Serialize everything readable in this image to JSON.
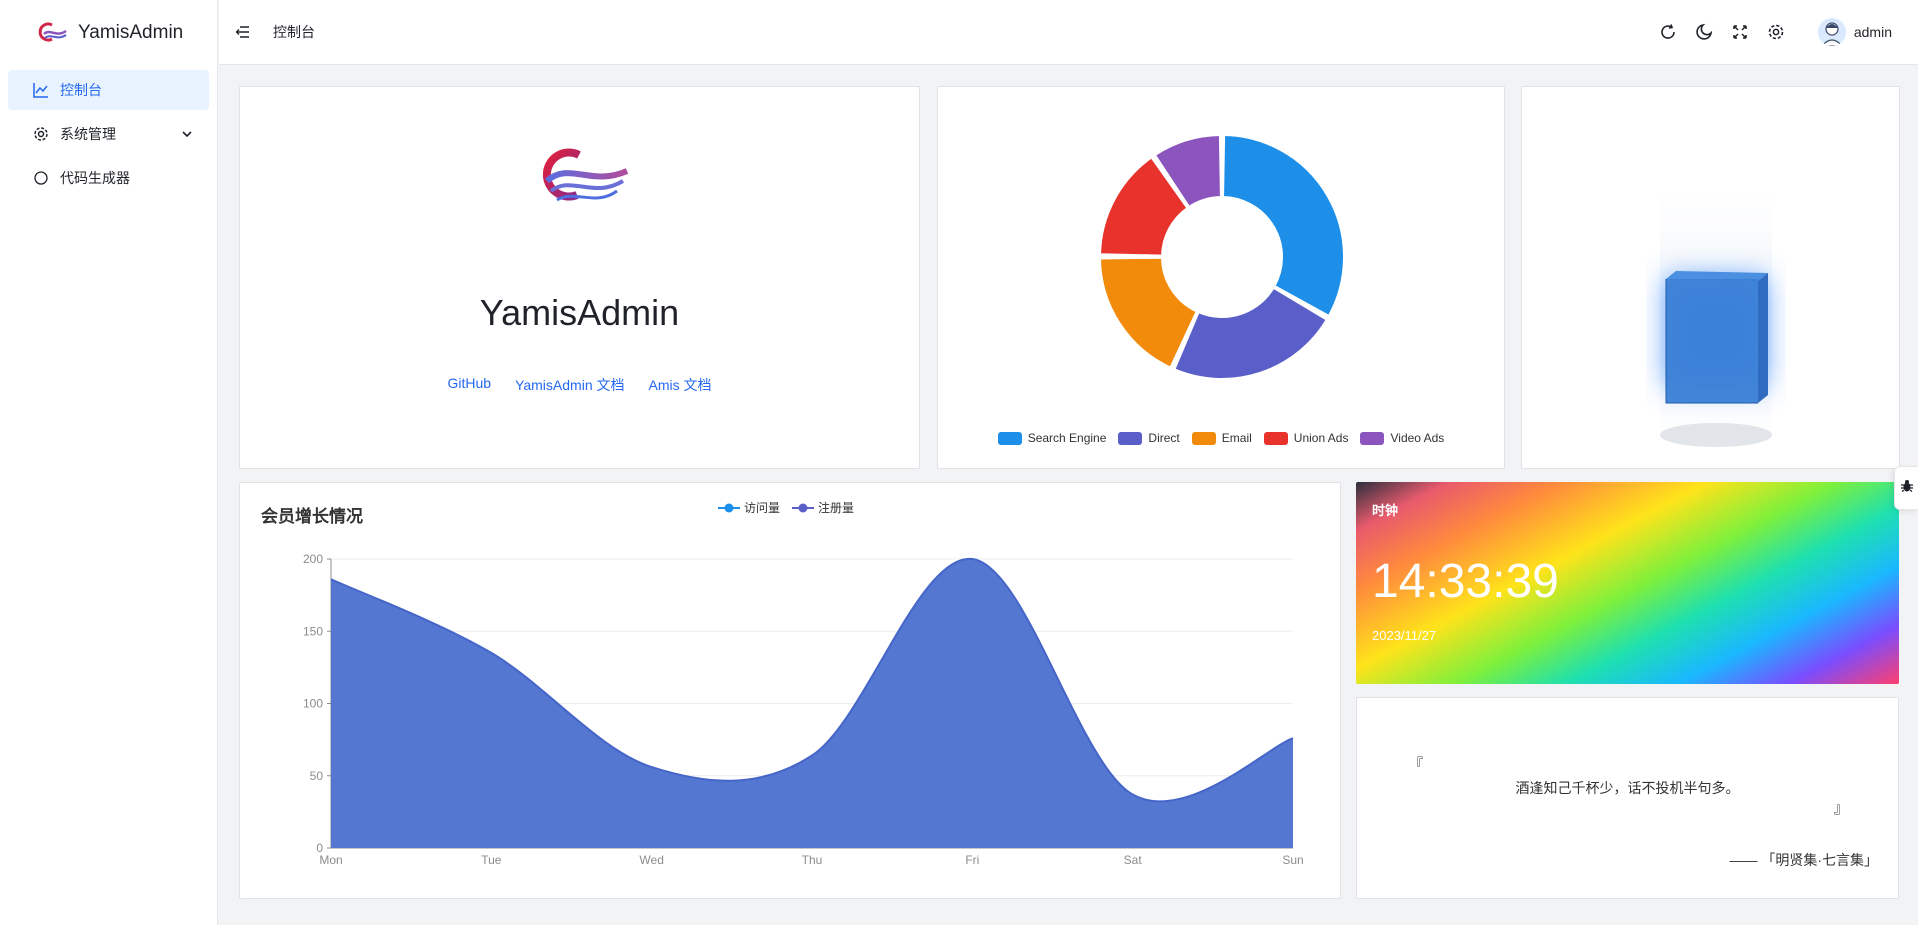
{
  "app": {
    "name": "YamisAdmin"
  },
  "sidebar": {
    "items": [
      {
        "label": "控制台",
        "icon": "line-chart-icon",
        "active": true
      },
      {
        "label": "系统管理",
        "icon": "gear-icon",
        "expandable": true
      },
      {
        "label": "代码生成器",
        "icon": "circle-icon"
      }
    ]
  },
  "header": {
    "breadcrumb": "控制台",
    "icons": [
      "refresh-icon",
      "moon-icon",
      "fullscreen-icon",
      "settings-icon"
    ],
    "user": "admin"
  },
  "intro": {
    "title": "YamisAdmin",
    "links": [
      "GitHub",
      "YamisAdmin 文档",
      "Amis 文档"
    ]
  },
  "pie_chart": {
    "chart_data": {
      "type": "pie",
      "series": [
        {
          "name": "Search Engine",
          "value": 1048,
          "color": "#1e8fe8"
        },
        {
          "name": "Direct",
          "value": 735,
          "color": "#5a5ec9"
        },
        {
          "name": "Email",
          "value": 580,
          "color": "#f28a0c"
        },
        {
          "name": "Union Ads",
          "value": 484,
          "color": "#e8322c"
        },
        {
          "name": "Video Ads",
          "value": 300,
          "color": "#8b55bd"
        }
      ],
      "legend": "bottom"
    }
  },
  "line_chart": {
    "title": "会员增长情况",
    "legend": [
      {
        "name": "访问量",
        "color": "#1e8fe8"
      },
      {
        "name": "注册量",
        "color": "#5a5ec9"
      }
    ],
    "chart_data": {
      "type": "area",
      "categories": [
        "Mon",
        "Tue",
        "Wed",
        "Thu",
        "Fri",
        "Sat",
        "Sun"
      ],
      "series": [
        {
          "name": "注册量",
          "values": [
            186,
            135,
            56,
            64,
            200,
            37,
            76
          ],
          "color": "#5477d2"
        }
      ],
      "yticks": [
        "0",
        "50",
        "100",
        "150",
        "200"
      ],
      "ylim": [
        0,
        200
      ],
      "grid": true
    }
  },
  "clock": {
    "title": "时钟",
    "time": "14:33:39",
    "date": "2023/11/27"
  },
  "quote": {
    "open": "『",
    "text": "酒逢知己千杯少，话不投机半句多。",
    "close": "』",
    "source": "—— 「明贤集·七言集」"
  }
}
